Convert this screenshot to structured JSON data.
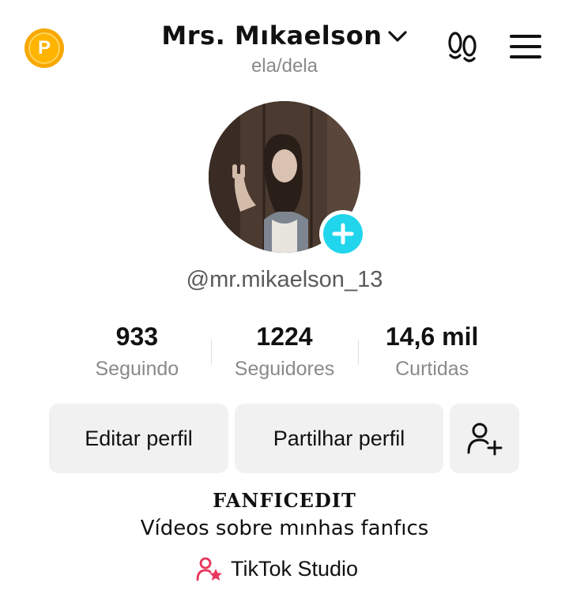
{
  "header": {
    "username": "Mrs. Mıkaelson",
    "pronouns": "ela/dela",
    "coin_letter": "P"
  },
  "profile": {
    "handle": "@mr.mikaelson_13"
  },
  "stats": [
    {
      "value": "933",
      "label": "Seguindo"
    },
    {
      "value": "1224",
      "label": "Seguidores"
    },
    {
      "value": "14,6 mil",
      "label": "Curtidas"
    }
  ],
  "actions": {
    "edit_label": "Editar perfil",
    "share_label": "Partilhar perfil"
  },
  "bio": {
    "title": "FANFICEDIT",
    "text": "Vídeos sobre mınhas fanfıcs"
  },
  "studio": {
    "label": "TikTok Studio"
  },
  "colors": {
    "accent_cyan": "#20d5ec",
    "coin": "#f7a800",
    "studio_icon": "#e8365d"
  },
  "icons": [
    "coin-icon",
    "chevron-down-icon",
    "footprints-icon",
    "menu-icon",
    "add-icon",
    "add-friend-icon",
    "studio-icon"
  ]
}
